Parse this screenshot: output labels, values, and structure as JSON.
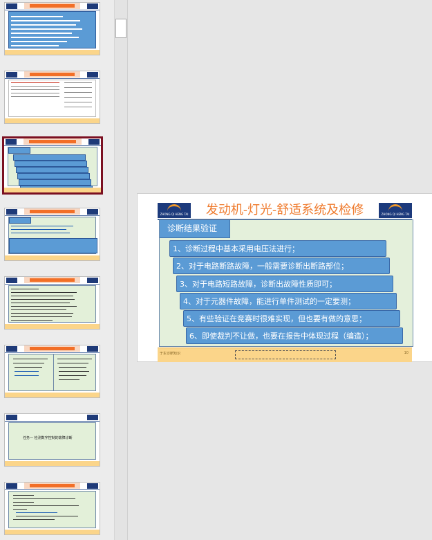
{
  "slide": {
    "header_title": "发动机-灯光-舒适系统及检修",
    "logo_text": "ZHONG QI HENG TAI",
    "section_tab": "诊断结果验证",
    "items": [
      "1、诊断过程中基本采用电压法进行；",
      "2、对于电路断路故障，一般需要诊断出断路部位；",
      "3、对于电路短路故障，诊断出故障性质即可；",
      "4、对于元器件故障，能进行单件测试的一定要测；",
      "5、有些验证在竞赛时很难实现，但也要有做的意思；",
      "6、即使裁判不让做，也要在报告中体现过程（编造）；"
    ],
    "footer_left": "于车诊断知识",
    "footer_right": "10"
  },
  "thumbnails": {
    "count": 8,
    "selected_index": 2,
    "slide7_text": "任务一 检测数字控制的故障诊断"
  },
  "colors": {
    "title_orange": "#ef7a2c",
    "box_blue": "#5b9bd5",
    "body_green": "#e4f0db",
    "footer_yellow": "#fbd58a",
    "selected_border": "#7b1021"
  }
}
